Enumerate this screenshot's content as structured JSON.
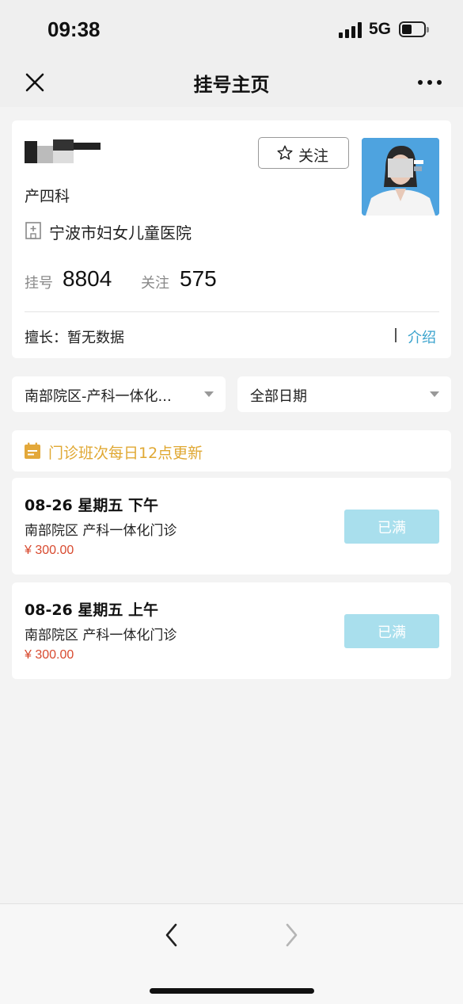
{
  "status_bar": {
    "time": "09:38",
    "network": "5G",
    "battery_level": 0.45
  },
  "nav": {
    "title": "挂号主页",
    "close_icon": "close-icon",
    "more_icon": "more-icon"
  },
  "doctor": {
    "department": "产四科",
    "hospital": "宁波市妇女儿童医院",
    "follow_label": "关注",
    "stats": {
      "register_label": "挂号",
      "register_count": "8804",
      "follow_label": "关注",
      "follow_count": "575"
    },
    "specialty": "擅长：暂无数据",
    "intro_link": "介绍"
  },
  "filters": {
    "campus": "南部院区-产科一体化...",
    "date": "全部日期"
  },
  "notice": "门诊班次每日12点更新",
  "schedules": [
    {
      "when": "08-26 星期五 下午",
      "where": "南部院区 产科一体化门诊",
      "price": "¥ 300.00",
      "status": "已满"
    },
    {
      "when": "08-26 星期五 上午",
      "where": "南部院区 产科一体化门诊",
      "price": "¥ 300.00",
      "status": "已满"
    }
  ],
  "colors": {
    "accent_blue": "#3aa3cd",
    "notice_gold": "#e0a833",
    "price_red": "#d84a2f",
    "full_button": "#a9dfed"
  }
}
